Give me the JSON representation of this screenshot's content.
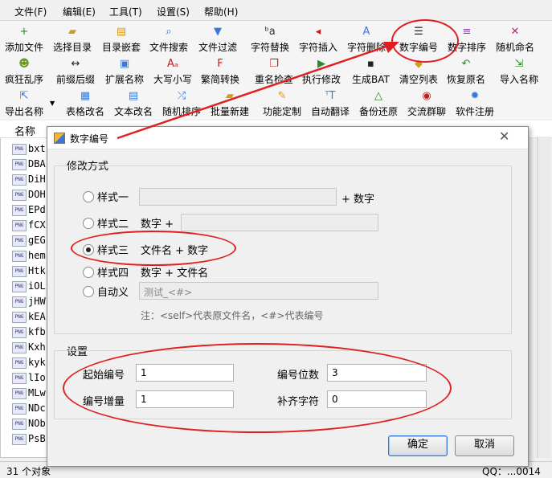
{
  "menu": [
    "文件(F)",
    "编辑(E)",
    "工具(T)",
    "设置(S)",
    "帮助(H)"
  ],
  "toolbar_row1": [
    {
      "label": "添加文件",
      "icon": "add-file-icon",
      "glyph": "+"
    },
    {
      "label": "选择目录",
      "icon": "folder-icon",
      "glyph": "▰"
    },
    {
      "label": "目录嵌套",
      "icon": "folder-nest-icon",
      "glyph": "▤"
    },
    {
      "label": "文件搜索",
      "icon": "search-icon",
      "glyph": "⌕"
    },
    {
      "label": "文件过滤",
      "icon": "filter-icon",
      "glyph": "▼"
    },
    {
      "label": "字符替换",
      "icon": "replace-icon",
      "glyph": "ᵇa"
    },
    {
      "label": "字符插入",
      "icon": "insert-icon",
      "glyph": "◂"
    },
    {
      "label": "字符删除",
      "icon": "delete-icon",
      "glyph": "A"
    },
    {
      "label": "数字编号",
      "icon": "numbering-icon",
      "glyph": "☰"
    },
    {
      "label": "数字排序",
      "icon": "sort-icon",
      "glyph": "≡"
    },
    {
      "label": "随机命名",
      "icon": "shuffle-icon",
      "glyph": "✕"
    }
  ],
  "toolbar_row2": [
    {
      "label": "疯狂乱序",
      "icon": "crazy-icon",
      "glyph": "☻"
    },
    {
      "label": "前缀后缀",
      "icon": "prefix-suffix-icon",
      "glyph": "↔"
    },
    {
      "label": "扩展名称",
      "icon": "extension-icon",
      "glyph": "▣"
    },
    {
      "label": "大写小写",
      "icon": "case-icon",
      "glyph": "Aₐ"
    },
    {
      "label": "繁简转换",
      "icon": "convert-icon",
      "glyph": "F"
    },
    {
      "label": "重名检查",
      "icon": "duplicate-icon",
      "glyph": "❐"
    },
    {
      "label": "执行修改",
      "icon": "run-icon",
      "glyph": "▶"
    },
    {
      "label": "生成BAT",
      "icon": "bat-icon",
      "glyph": "▪"
    },
    {
      "label": "清空列表",
      "icon": "clear-icon",
      "glyph": "◆"
    },
    {
      "label": "恢复原名",
      "icon": "restore-icon",
      "glyph": "↶"
    },
    {
      "label": "导入名称",
      "icon": "import-icon",
      "glyph": "⇲"
    }
  ],
  "toolbar_row3": [
    {
      "label": "导出名称",
      "icon": "export-icon",
      "glyph": "⇱"
    },
    {
      "label": "表格改名",
      "icon": "table-icon",
      "glyph": "▦"
    },
    {
      "label": "文本改名",
      "icon": "text-icon",
      "glyph": "▤"
    },
    {
      "label": "随机排序",
      "icon": "random-sort-icon",
      "glyph": "⤮"
    },
    {
      "label": "批量新建",
      "icon": "new-folder-icon",
      "glyph": "▰"
    },
    {
      "label": "功能定制",
      "icon": "tools-icon",
      "glyph": "✎"
    },
    {
      "label": "自动翻译",
      "icon": "translate-icon",
      "glyph": "ᵀT"
    },
    {
      "label": "备份还原",
      "icon": "backup-icon",
      "glyph": "△"
    },
    {
      "label": "交流群聊",
      "icon": "chat-icon",
      "glyph": "◉"
    },
    {
      "label": "软件注册",
      "icon": "register-icon",
      "glyph": "✹"
    }
  ],
  "filelist": {
    "header": "名称",
    "badge": "PNG",
    "rows": [
      "bxt",
      "DBA",
      "DiH",
      "DOH",
      "EPd",
      "fCX",
      "gEG",
      "hem",
      "Htk",
      "iOL",
      "jHW",
      "kEA",
      "kfb",
      "Kxh",
      "kyk",
      "lIo",
      "MLw",
      "NDc",
      "NOb",
      "PsB"
    ]
  },
  "status": {
    "count": "31 个对象",
    "trailing": "QQ：...0014"
  },
  "dialog": {
    "title": "数字编号",
    "group1_title": "修改方式",
    "options": [
      {
        "label": "样式一",
        "suffix": "+ 数字",
        "value": ""
      },
      {
        "label": "样式二",
        "prefix": "数字 +",
        "value": ""
      },
      {
        "label": "样式三",
        "text": "文件名 + 数字"
      },
      {
        "label": "样式四",
        "text": "数字 + 文件名"
      },
      {
        "label": "自动义",
        "value": "测试_<#>"
      }
    ],
    "note": "注：<self>代表原文件名，<#>代表编号",
    "group2_title": "设置",
    "start_label": "起始编号",
    "start_value": "1",
    "digits_label": "编号位数",
    "digits_value": "3",
    "increment_label": "编号增量",
    "increment_value": "1",
    "pad_label": "补齐字符",
    "pad_value": "0",
    "ok": "确定",
    "cancel": "取消"
  },
  "colors": {
    "annotation_red": "#e02020",
    "accent_blue": "#3a78d8"
  }
}
